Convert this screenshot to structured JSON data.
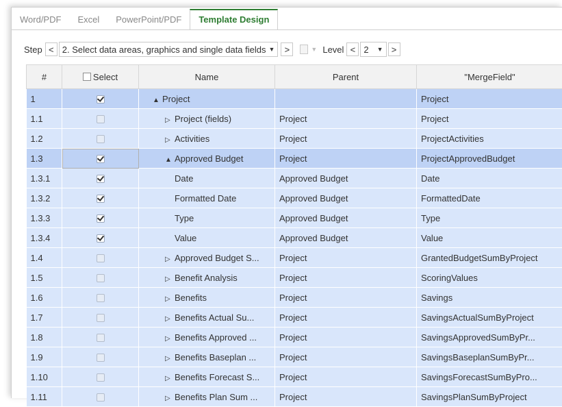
{
  "tabs": [
    {
      "label": "Word/PDF",
      "active": false
    },
    {
      "label": "Excel",
      "active": false
    },
    {
      "label": "PowerPoint/PDF",
      "active": false
    },
    {
      "label": "Template Design",
      "active": true
    }
  ],
  "toolbar": {
    "step_label": "Step",
    "prev": "<",
    "next": ">",
    "step_value": "2. Select data areas, graphics and single data fields",
    "level_label": "Level",
    "level_value": "2"
  },
  "table": {
    "headers": {
      "num": "#",
      "select": "Select",
      "name": "Name",
      "parent": "Parent",
      "mergefield": "\"MergeField\""
    },
    "rows": [
      {
        "num": "1",
        "checked": true,
        "tree": "▲",
        "indent": 0,
        "name": "Project",
        "parent": "",
        "mergefield": "Project",
        "style": "sel"
      },
      {
        "num": "1.1",
        "checked": false,
        "tree": "▷",
        "indent": 1,
        "name": "Project (fields)",
        "parent": "Project",
        "mergefield": "Project",
        "style": "light"
      },
      {
        "num": "1.2",
        "checked": false,
        "tree": "▷",
        "indent": 1,
        "name": "Activities",
        "parent": "Project",
        "mergefield": "ProjectActivities",
        "style": "light"
      },
      {
        "num": "1.3",
        "checked": true,
        "tree": "▲",
        "indent": 1,
        "name": "Approved Budget",
        "parent": "Project",
        "mergefield": "ProjectApprovedBudget",
        "style": "sel"
      },
      {
        "num": "1.3.1",
        "checked": true,
        "tree": "",
        "indent": 2,
        "name": "Date",
        "parent": "Approved Budget",
        "mergefield": "Date",
        "style": "light"
      },
      {
        "num": "1.3.2",
        "checked": true,
        "tree": "",
        "indent": 2,
        "name": "Formatted Date",
        "parent": "Approved Budget",
        "mergefield": "FormattedDate",
        "style": "light"
      },
      {
        "num": "1.3.3",
        "checked": true,
        "tree": "",
        "indent": 2,
        "name": "Type",
        "parent": "Approved Budget",
        "mergefield": "Type",
        "style": "light"
      },
      {
        "num": "1.3.4",
        "checked": true,
        "tree": "",
        "indent": 2,
        "name": "Value",
        "parent": "Approved Budget",
        "mergefield": "Value",
        "style": "light"
      },
      {
        "num": "1.4",
        "checked": false,
        "tree": "▷",
        "indent": 1,
        "name": "Approved Budget S...",
        "parent": "Project",
        "mergefield": "GrantedBudgetSumByProject",
        "style": "light"
      },
      {
        "num": "1.5",
        "checked": false,
        "tree": "▷",
        "indent": 1,
        "name": "Benefit Analysis",
        "parent": "Project",
        "mergefield": "ScoringValues",
        "style": "light"
      },
      {
        "num": "1.6",
        "checked": false,
        "tree": "▷",
        "indent": 1,
        "name": "Benefits",
        "parent": "Project",
        "mergefield": "Savings",
        "style": "light"
      },
      {
        "num": "1.7",
        "checked": false,
        "tree": "▷",
        "indent": 1,
        "name": "Benefits Actual Su...",
        "parent": "Project",
        "mergefield": "SavingsActualSumByProject",
        "style": "light"
      },
      {
        "num": "1.8",
        "checked": false,
        "tree": "▷",
        "indent": 1,
        "name": "Benefits Approved ...",
        "parent": "Project",
        "mergefield": "SavingsApprovedSumByPr...",
        "style": "light"
      },
      {
        "num": "1.9",
        "checked": false,
        "tree": "▷",
        "indent": 1,
        "name": "Benefits Baseplan ...",
        "parent": "Project",
        "mergefield": "SavingsBaseplanSumByPr...",
        "style": "light"
      },
      {
        "num": "1.10",
        "checked": false,
        "tree": "▷",
        "indent": 1,
        "name": "Benefits Forecast S...",
        "parent": "Project",
        "mergefield": "SavingsForecastSumByPro...",
        "style": "light"
      },
      {
        "num": "1.11",
        "checked": false,
        "tree": "▷",
        "indent": 1,
        "name": "Benefits Plan Sum ...",
        "parent": "Project",
        "mergefield": "SavingsPlanSumByProject",
        "style": "light"
      }
    ]
  }
}
